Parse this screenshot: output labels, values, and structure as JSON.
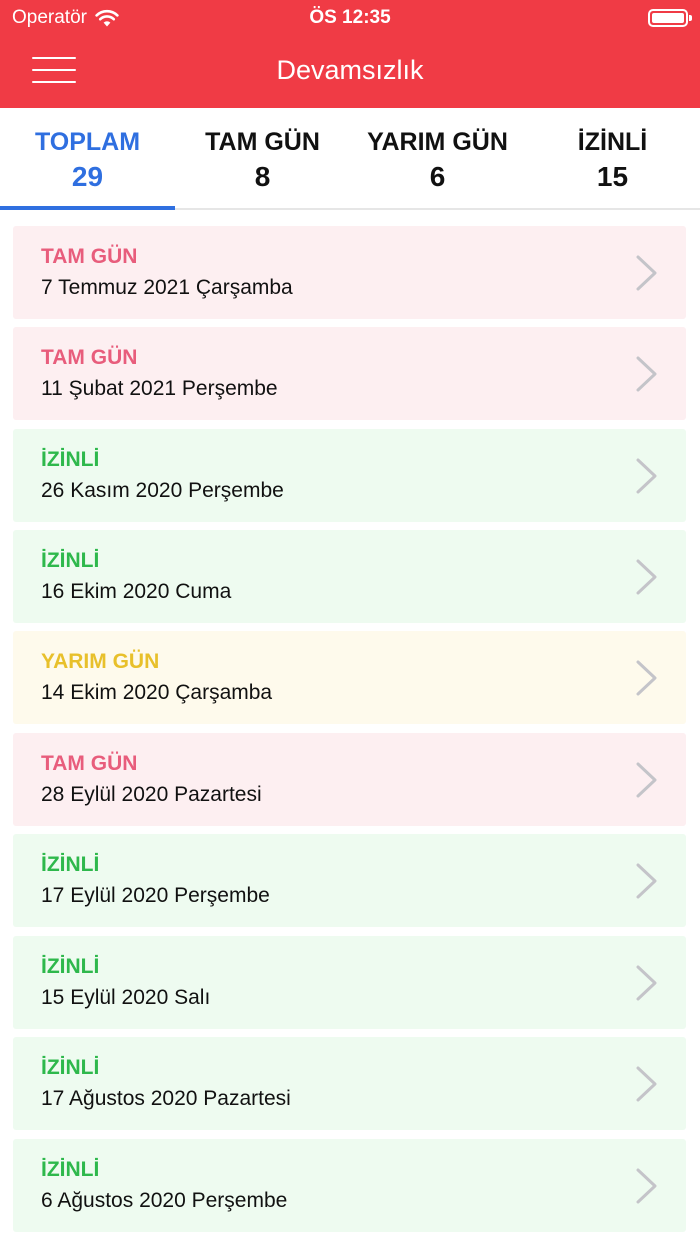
{
  "status_bar": {
    "carrier": "Operatör",
    "time": "ÖS 12:35"
  },
  "header": {
    "title": "Devamsızlık"
  },
  "tabs": [
    {
      "label": "TOPLAM",
      "count": "29",
      "active": true
    },
    {
      "label": "TAM GÜN",
      "count": "8",
      "active": false
    },
    {
      "label": "YARIM GÜN",
      "count": "6",
      "active": false
    },
    {
      "label": "İZİNLİ",
      "count": "15",
      "active": false
    }
  ],
  "colors": {
    "header": "#f03b45",
    "active_tab": "#2f6fe0",
    "tam_gun": "#e85d7c",
    "izinli": "#2eb84c",
    "yarim_gun": "#e8c02b"
  },
  "records": [
    {
      "type": "TAM GÜN",
      "date": "7 Temmuz 2021 Çarşamba"
    },
    {
      "type": "TAM GÜN",
      "date": "11 Şubat 2021 Perşembe"
    },
    {
      "type": "İZİNLİ",
      "date": "26 Kasım 2020 Perşembe"
    },
    {
      "type": "İZİNLİ",
      "date": "16 Ekim 2020 Cuma"
    },
    {
      "type": "YARIM GÜN",
      "date": "14 Ekim 2020 Çarşamba"
    },
    {
      "type": "TAM GÜN",
      "date": "28 Eylül 2020 Pazartesi"
    },
    {
      "type": "İZİNLİ",
      "date": "17 Eylül 2020 Perşembe"
    },
    {
      "type": "İZİNLİ",
      "date": "15 Eylül 2020 Salı"
    },
    {
      "type": "İZİNLİ",
      "date": "17 Ağustos 2020 Pazartesi"
    },
    {
      "type": "İZİNLİ",
      "date": "6 Ağustos 2020 Perşembe"
    }
  ]
}
